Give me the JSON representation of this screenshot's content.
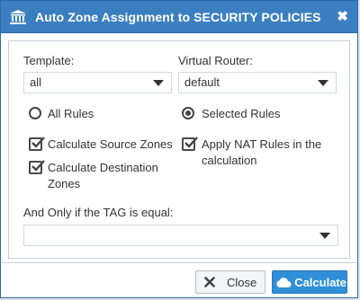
{
  "dialog": {
    "title": "Auto Zone Assignment to SECURITY POLICIES",
    "close_glyph": "✖",
    "colors": {
      "titlebar": "#3c7fc0",
      "primary_button": "#2f8fd8"
    }
  },
  "form": {
    "template": {
      "label": "Template:",
      "value": "all"
    },
    "virtual_router": {
      "label": "Virtual Router:",
      "value": "default"
    },
    "scope": {
      "all_rules_label": "All Rules",
      "selected_rules_label": "Selected Rules",
      "selected": "Selected Rules"
    },
    "options": {
      "calc_source_label": "Calculate Source Zones",
      "calc_source_checked": true,
      "calc_dest_line1": "Calculate Destination",
      "calc_dest_line2": "Zones",
      "calc_dest_checked": true,
      "apply_nat_line1": "Apply NAT Rules in the",
      "apply_nat_line2": "calculation",
      "apply_nat_checked": true
    },
    "tag": {
      "label": "And Only if the TAG is equal:",
      "value": ""
    }
  },
  "footer": {
    "close_label": "Close",
    "calculate_label": "Calculate",
    "close_icon": "x-icon",
    "calculate_icon": "cloud-icon"
  }
}
